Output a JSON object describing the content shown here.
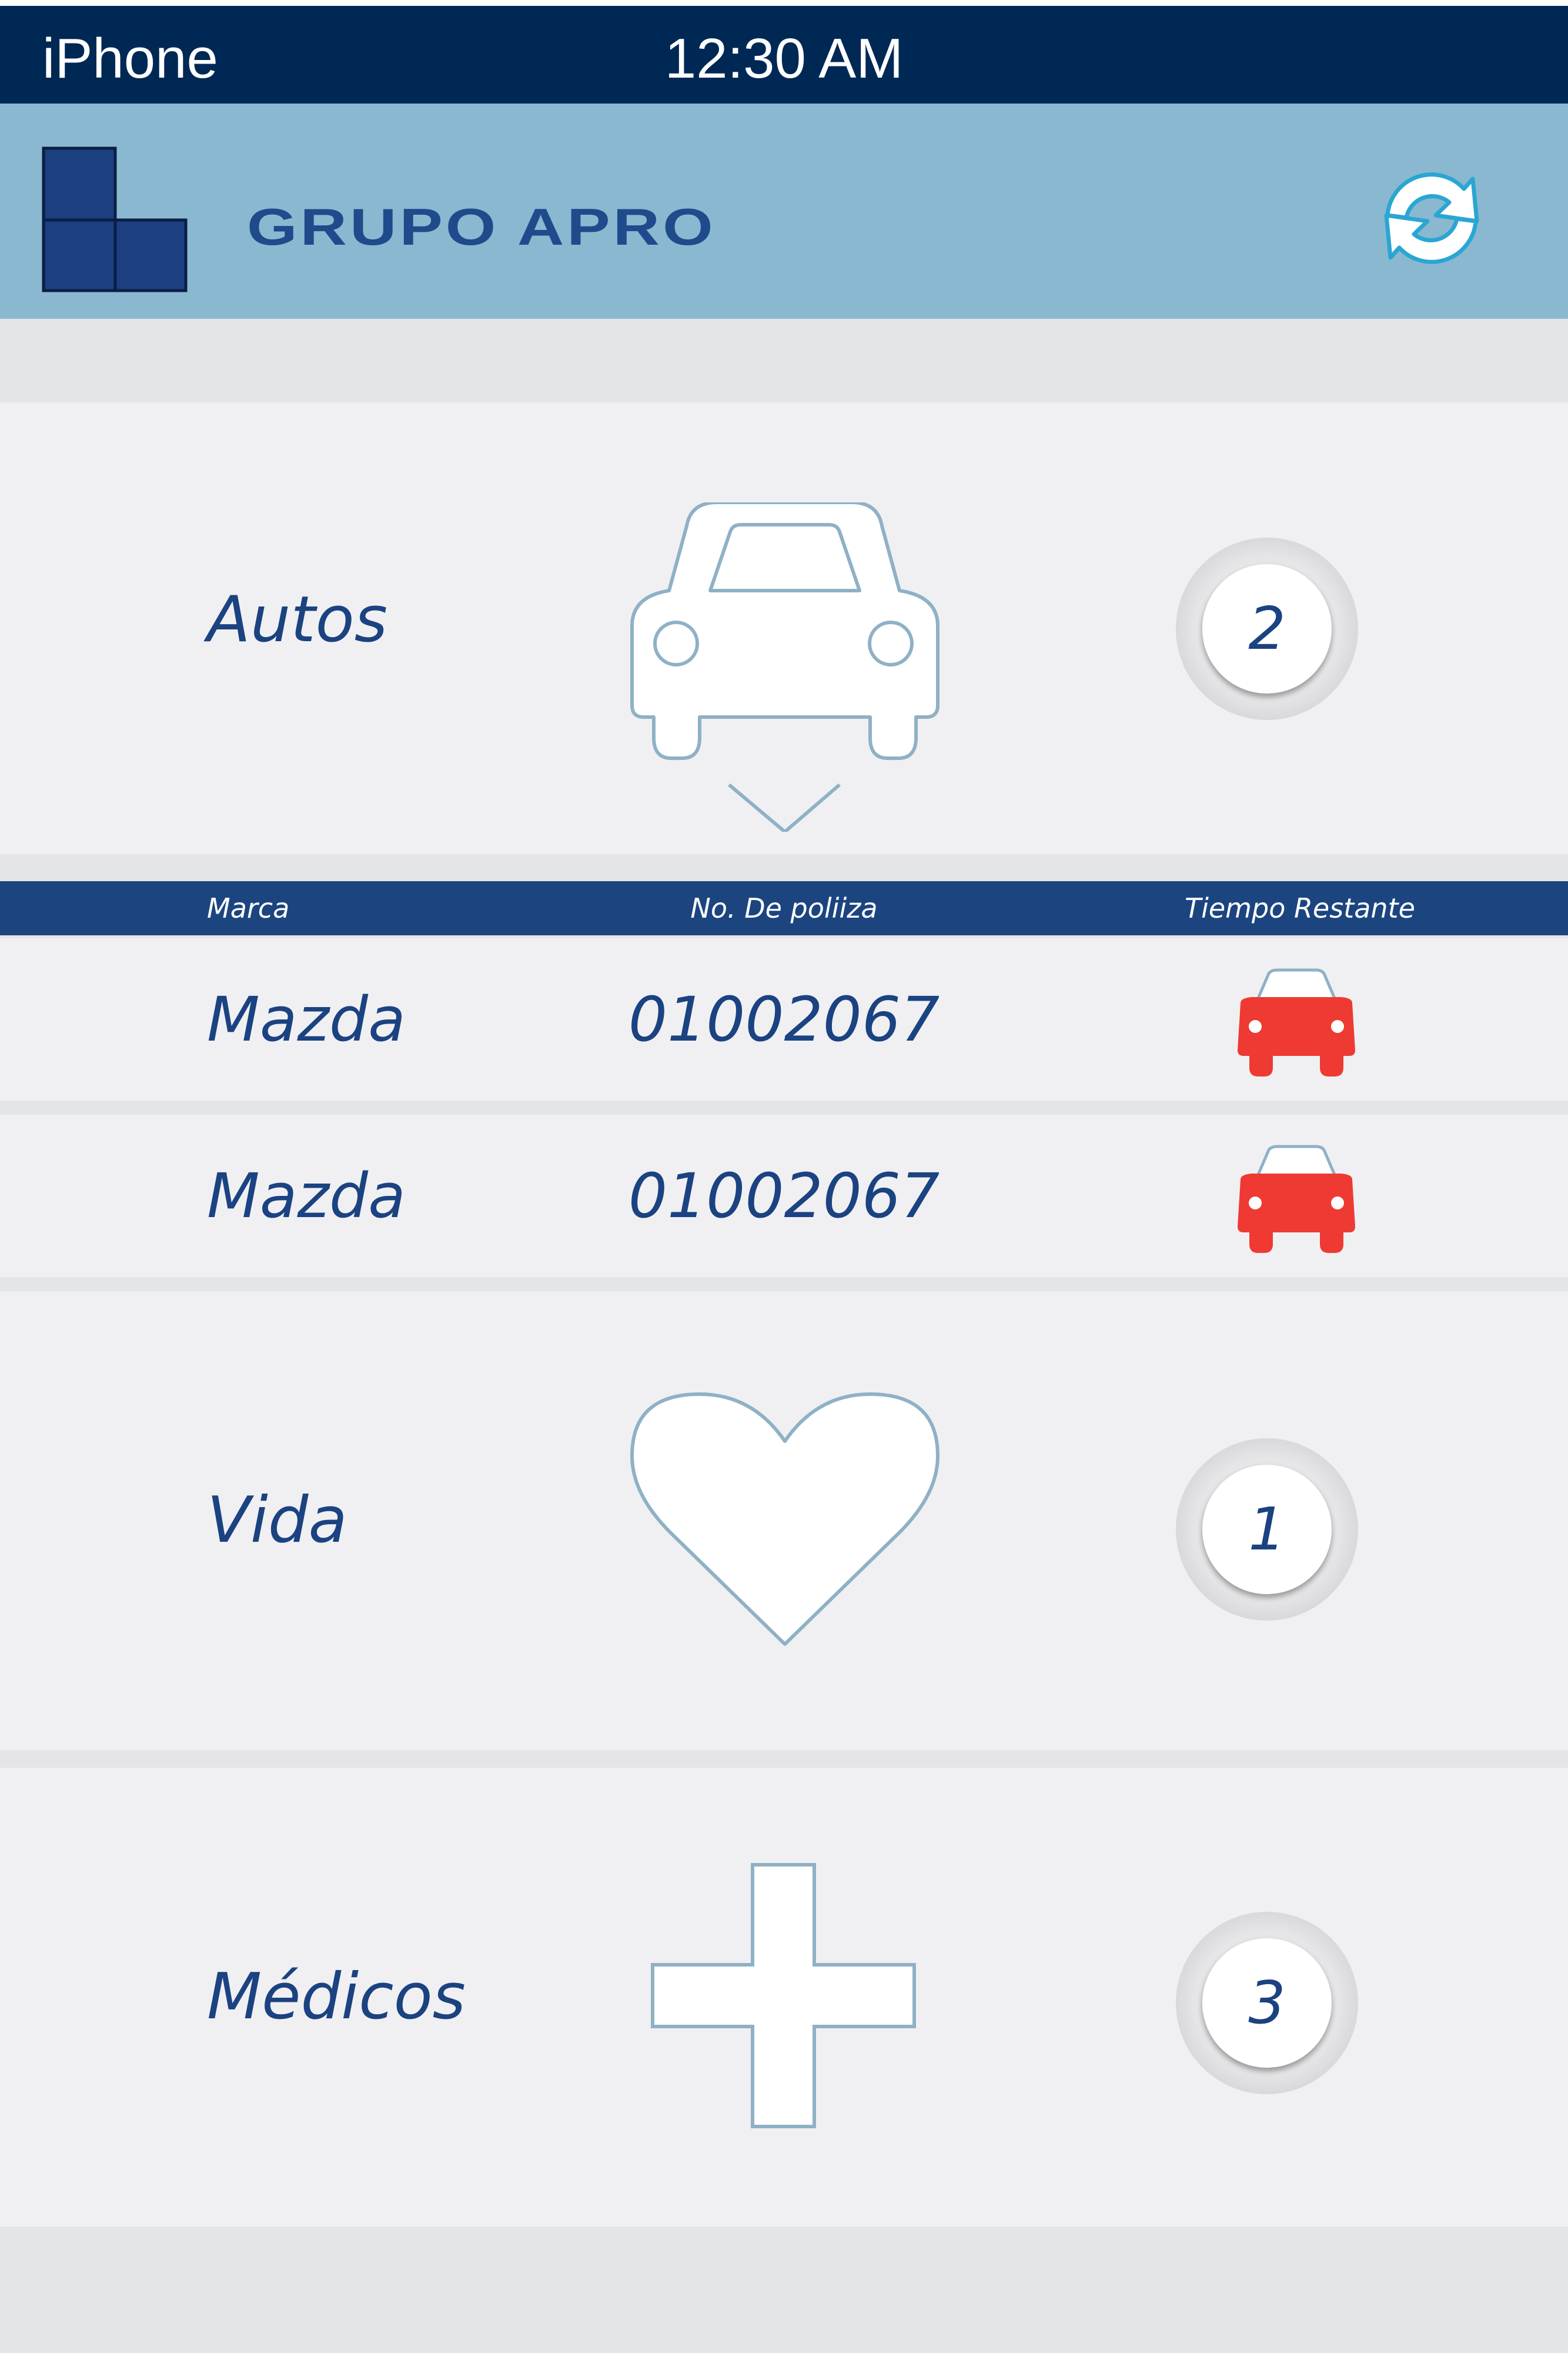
{
  "status_bar": {
    "carrier": "iPhone",
    "time": "12:30 AM"
  },
  "header": {
    "brand": "GRUPO APRO",
    "logo_icon": "grupo-apro-logo",
    "refresh_icon": "refresh-icon"
  },
  "sections": {
    "autos": {
      "label": "Autos",
      "count": "2",
      "icon": "car-icon"
    },
    "vida": {
      "label": "Vida",
      "count": "1",
      "icon": "heart-icon"
    },
    "medicos": {
      "label": "Médicos",
      "count": "3",
      "icon": "medical-cross-icon"
    }
  },
  "autos_table": {
    "columns": [
      "Marca",
      "No. De poliiza",
      "Tiempo Restante"
    ],
    "rows": [
      {
        "marca": "Mazda",
        "poliza": "01002067",
        "status_icon": "car-red-icon"
      },
      {
        "marca": "Mazda",
        "poliza": "01002067",
        "status_icon": "car-red-icon"
      }
    ]
  },
  "colors": {
    "status_bar": "#002855",
    "header": "#8ab8d0",
    "brand_blue": "#1b4281",
    "icon_outline": "#8fb1c6",
    "alert_red": "#ee3a32"
  }
}
